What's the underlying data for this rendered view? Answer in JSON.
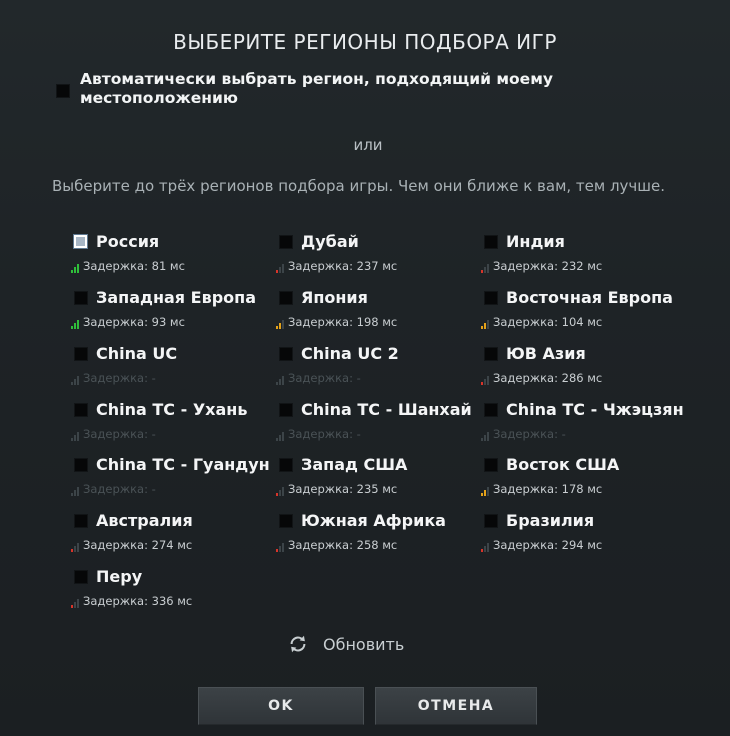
{
  "dialog": {
    "title": "ВЫБЕРИТЕ РЕГИОНЫ ПОДБОРА ИГР",
    "auto_select_label": "Автоматически выбрать регион, подходящий моему местоположению",
    "or_text": "или",
    "hint_text": "Выберите до трёх регионов подбора игры. Чем они ближе к вам, тем лучше.",
    "refresh_label": "Обновить",
    "ok_label": "OK",
    "cancel_label": "ОТМЕНА"
  },
  "colors": {
    "signal_good": "#2fbf3a",
    "signal_medium": "#e4a21a",
    "signal_bad": "#d8342a",
    "signal_none": "#3c4448"
  },
  "regions": [
    {
      "name": "Россия",
      "ping": "Задержка: 81 мс",
      "signal": "good",
      "focused": true
    },
    {
      "name": "Дубай",
      "ping": "Задержка: 237 мс",
      "signal": "bad"
    },
    {
      "name": "Индия",
      "ping": "Задержка: 232 мс",
      "signal": "bad"
    },
    {
      "name": "Западная Европа",
      "ping": "Задержка: 93 мс",
      "signal": "good"
    },
    {
      "name": "Япония",
      "ping": "Задержка: 198 мс",
      "signal": "medium"
    },
    {
      "name": "Восточная Европа",
      "ping": "Задержка: 104 мс",
      "signal": "medium"
    },
    {
      "name": "China UC",
      "ping": "Задержка: -",
      "signal": "none"
    },
    {
      "name": "China UC 2",
      "ping": "Задержка: -",
      "signal": "none"
    },
    {
      "name": "ЮВ Азия",
      "ping": "Задержка: 286 мс",
      "signal": "bad"
    },
    {
      "name": "China TC - Ухань",
      "ping": "Задержка: -",
      "signal": "none"
    },
    {
      "name": "China TC - Шанхай",
      "ping": "Задержка: -",
      "signal": "none"
    },
    {
      "name": "China TC - Чжэцзян",
      "ping": "Задержка: -",
      "signal": "none"
    },
    {
      "name": "China TC - Гуандун",
      "ping": "Задержка: -",
      "signal": "none"
    },
    {
      "name": "Запад США",
      "ping": "Задержка: 235 мс",
      "signal": "bad"
    },
    {
      "name": "Восток США",
      "ping": "Задержка: 178 мс",
      "signal": "medium"
    },
    {
      "name": "Австралия",
      "ping": "Задержка: 274 мс",
      "signal": "bad"
    },
    {
      "name": "Южная Африка",
      "ping": "Задержка: 258 мс",
      "signal": "bad"
    },
    {
      "name": "Бразилия",
      "ping": "Задержка: 294 мс",
      "signal": "bad"
    },
    {
      "name": "Перу",
      "ping": "Задержка: 336 мс",
      "signal": "bad"
    }
  ]
}
